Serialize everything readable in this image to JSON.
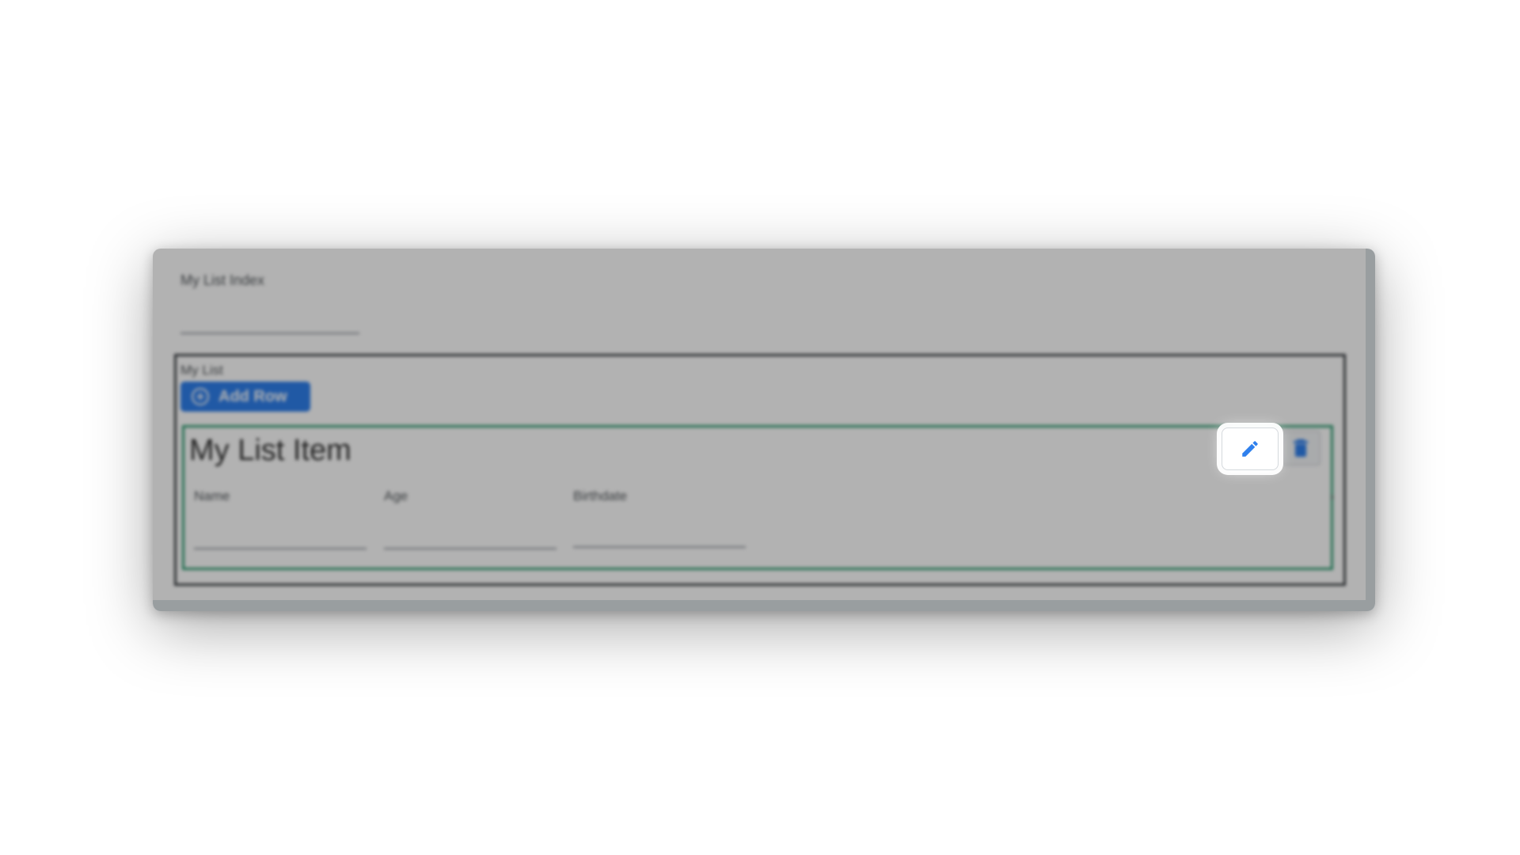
{
  "form": {
    "index_label": "My List Index",
    "list_label": "My List",
    "add_row_label": "Add Row",
    "item_title": "My List Item",
    "fields": {
      "name_label": "Name",
      "age_label": "Age",
      "birthdate_label": "Birthdate"
    }
  },
  "icons": {
    "add": "plus-circle-icon",
    "edit": "pencil-icon",
    "delete": "trash-icon",
    "expand": "chevron-right-icon"
  },
  "colors": {
    "primary": "#2f80ed",
    "item_border": "#2f9e72",
    "highlight_glow": "#ffffff"
  }
}
